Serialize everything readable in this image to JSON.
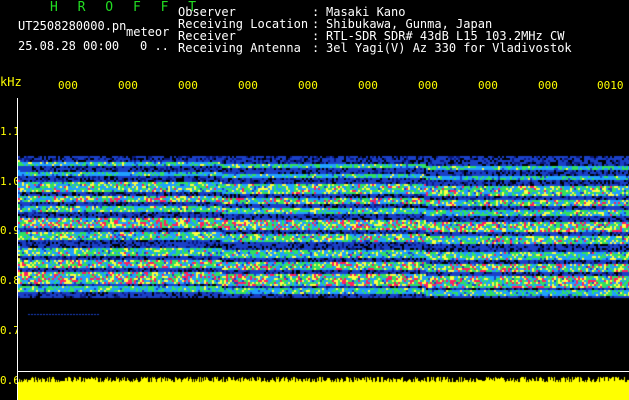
{
  "header": {
    "brand": "H R O F F T",
    "filename": "UT2508280000.pn",
    "meteor_label": "meteor",
    "datetime": "25.08.28 00:00",
    "count": "0 ..",
    "info": [
      {
        "label": "Observer",
        "value": "Masaki Kano"
      },
      {
        "label": "Receiving Location",
        "value": "Shibukawa, Gunma, Japan"
      },
      {
        "label": "Receiver",
        "value": "RTL-SDR SDR# 43dB L15 103.2MHz CW"
      },
      {
        "label": "Receiving Antenna",
        "value": "3el Yagi(V) Az 330 for Vladivostok"
      }
    ],
    "separator": ":"
  },
  "axis": {
    "y_unit": "kHz",
    "y_ticks": [
      "1.1",
      "1.0",
      "0.9",
      "0.8",
      "0.7",
      "0.6"
    ],
    "x_ticks": [
      "000",
      "000",
      "000",
      "000",
      "000",
      "000",
      "000",
      "000",
      "000",
      "0010"
    ]
  },
  "colors": {
    "background": "#000000",
    "header_text": "#ffffff",
    "brand_text": "#22dd22",
    "axis_text": "#ffff00",
    "noise_floor": "#ffff00"
  }
}
